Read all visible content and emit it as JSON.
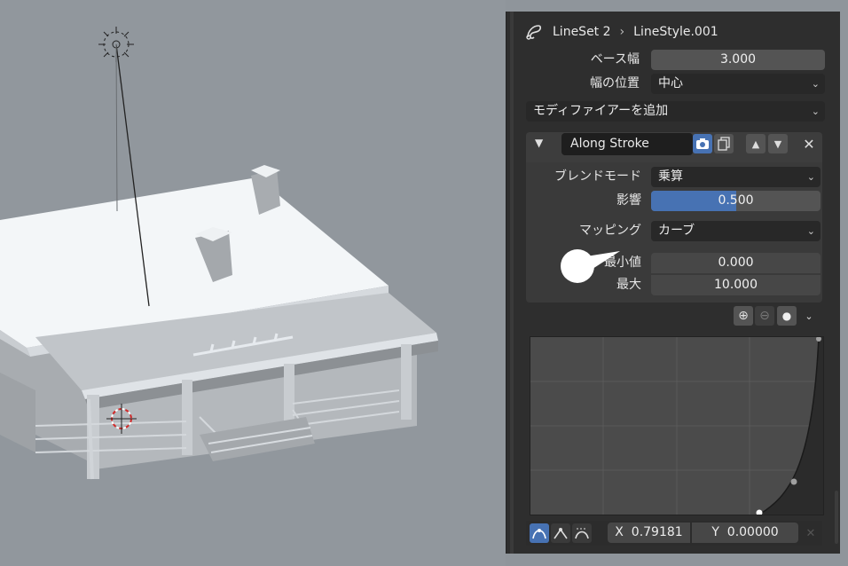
{
  "breadcrumb": {
    "lineset": "LineSet 2",
    "separator": "›",
    "linestyle": "LineStyle.001"
  },
  "properties": {
    "base_width_label": "ベース幅",
    "base_width_value": "3.000",
    "width_position_label": "幅の位置",
    "width_position_value": "中心",
    "add_modifier_label": "モディファイアーを追加"
  },
  "modifier": {
    "name": "Along Stroke",
    "blend_mode_label": "ブレンドモード",
    "blend_mode_value": "乗算",
    "influence_label": "影響",
    "influence_value": "0.500",
    "influence_fraction": 0.5,
    "mapping_label": "マッピング",
    "mapping_value": "カーブ",
    "min_label": "最小値",
    "min_value": "0.000",
    "max_label": "最大",
    "max_value": "10.000"
  },
  "curve_footer": {
    "x_label": "X",
    "x_value": "0.79181",
    "y_label": "Y",
    "y_value": "0.00000"
  },
  "colors": {
    "accent_blue": "#4772b3",
    "panel_bg": "#2e2e2e",
    "field_bg": "#545454",
    "viewport_bg": "#91979d"
  }
}
